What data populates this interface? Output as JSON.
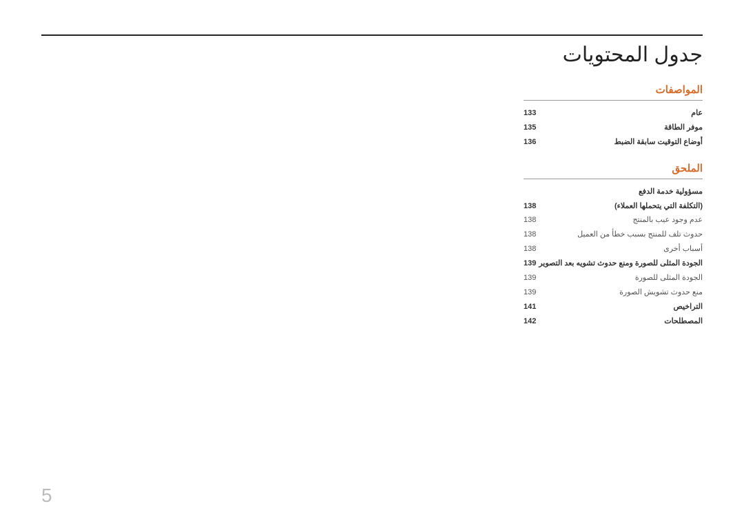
{
  "title": "جدول المحتويات",
  "page_number": "5",
  "sections": [
    {
      "heading": "المواصفات",
      "entries": [
        {
          "label": "عام",
          "page": "133",
          "bold": true
        },
        {
          "label": "موفر الطاقة",
          "page": "135",
          "bold": true
        },
        {
          "label": "أوضاع التوقيت سابقة الضبط",
          "page": "136",
          "bold": true
        }
      ]
    },
    {
      "heading": "الملحق",
      "entries": [
        {
          "label": "مسؤولية خدمة الدفع",
          "page": "",
          "bold": true
        },
        {
          "label": "(التكلفة التي يتحملها العملاء)",
          "page": "138",
          "bold": true
        },
        {
          "label": "عدم وجود عيب بالمنتج",
          "page": "138",
          "bold": false
        },
        {
          "label": "حدوث تلف للمنتج بسبب خطأ من العميل",
          "page": "138",
          "bold": false
        },
        {
          "label": "أسباب أخرى",
          "page": "138",
          "bold": false
        },
        {
          "label": "الجودة المثلى للصورة ومنع حدوث تشويه بعد التصوير",
          "page": "139",
          "bold": true
        },
        {
          "label": "الجودة المثلى للصورة",
          "page": "139",
          "bold": false
        },
        {
          "label": "منع حدوث تشويش الصورة",
          "page": "139",
          "bold": false
        },
        {
          "label": "التراخيص",
          "page": "141",
          "bold": true
        },
        {
          "label": "المصطلحات",
          "page": "142",
          "bold": true
        }
      ]
    }
  ]
}
